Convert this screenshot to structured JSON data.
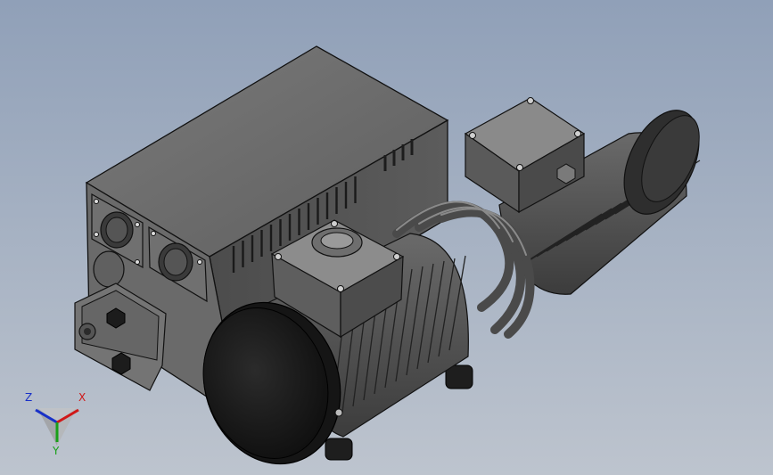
{
  "viewport": {
    "background_top": "#90a0b8",
    "background_bottom": "#bdc4ce"
  },
  "model": {
    "body_color": "#5f5f5f",
    "body_dark": "#3f3f3f",
    "body_light": "#767676",
    "fan_cover_color": "#1c1c1c"
  },
  "triad": {
    "x_label": "X",
    "y_label": "Y",
    "z_label": "Z",
    "x_color": "#d01818",
    "y_color": "#18a018",
    "z_color": "#1830c8"
  }
}
